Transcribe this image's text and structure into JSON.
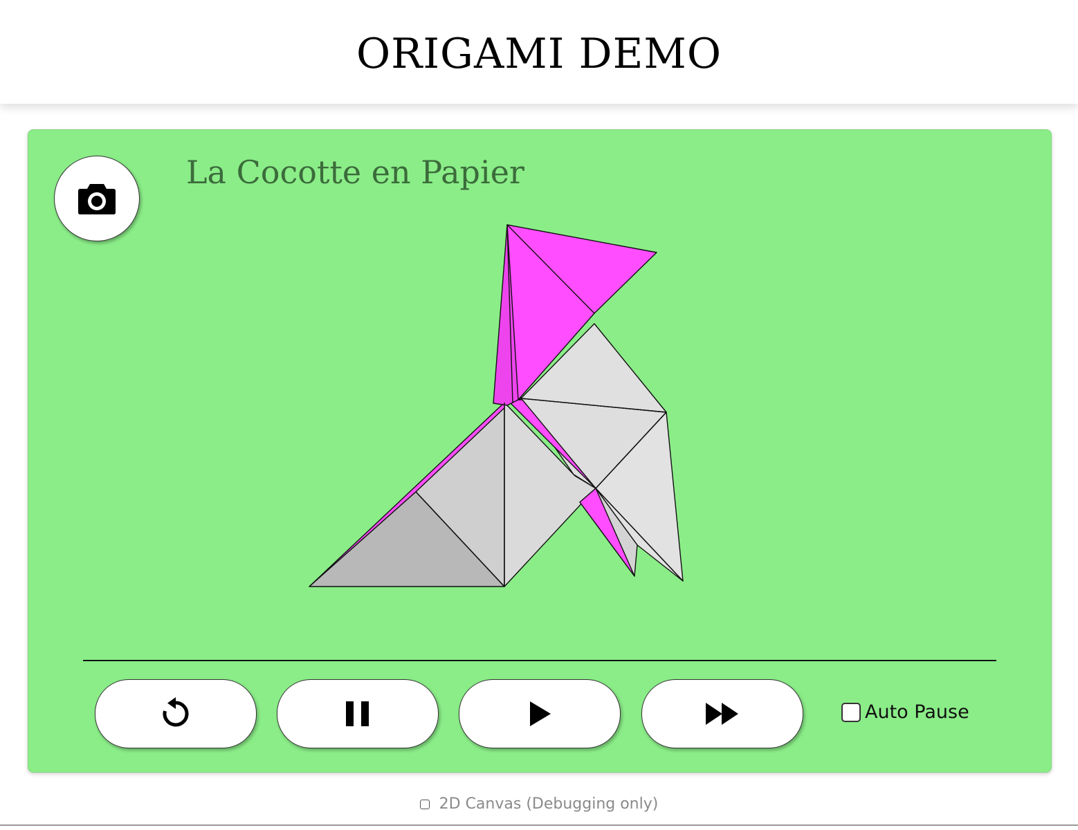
{
  "header": {
    "title": "ORIGAMI DEMO"
  },
  "viewer": {
    "model_title": "La Cocotte en Papier",
    "background_color": "#8bed88",
    "paper_front_color": "#ff4dff",
    "paper_back_color": "#d9d9d9",
    "camera_icon": "camera-icon"
  },
  "controls": {
    "buttons": [
      {
        "name": "reset-button",
        "icon": "reset-icon"
      },
      {
        "name": "pause-button",
        "icon": "pause-icon"
      },
      {
        "name": "play-button",
        "icon": "play-icon"
      },
      {
        "name": "fast-forward-button",
        "icon": "fast-forward-icon"
      }
    ],
    "auto_pause_label": "Auto Pause",
    "auto_pause_checked": false
  },
  "footer": {
    "debug_label": "2D Canvas (Debugging only)",
    "debug_checked": false
  }
}
